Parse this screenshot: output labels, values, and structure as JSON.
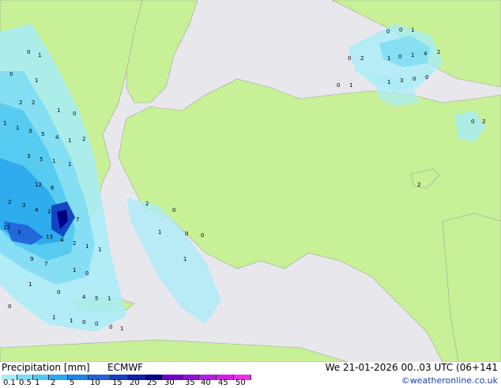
{
  "legend": {
    "title": "Precipitation [mm]",
    "model": "ECMWF",
    "valid_time": "We 21-01-2026 00..03 UTC (06+141",
    "credit": "©weatheronline.co.uk",
    "scale_labels": [
      "0.1",
      "0.5",
      "1",
      "2",
      "5",
      "10",
      "15",
      "20",
      "25",
      "30",
      "35",
      "40",
      "45",
      "50"
    ],
    "scale_colors": [
      "#a8ecf8",
      "#7cdcf4",
      "#50c8f0",
      "#2aa8ec",
      "#2080e8",
      "#2060d8",
      "#1840c0",
      "#1020a8",
      "#00008c",
      "#7000c8",
      "#9010d8",
      "#b020e0",
      "#d020e8",
      "#e830e8"
    ]
  },
  "colors": {
    "land": "#c8f096",
    "sea": "#e8e8ec",
    "coast": "#a0a0a0"
  },
  "map_labels": [
    "0",
    "0",
    "1",
    "0",
    "2",
    "1",
    "0",
    "1",
    "4",
    "2",
    "0",
    "1",
    "1",
    "3",
    "0",
    "0",
    "0",
    "1",
    "0",
    "1",
    "2",
    "2",
    "1",
    "0",
    "1",
    "1",
    "3",
    "5",
    "4",
    "1",
    "2",
    "12",
    "6",
    "3",
    "5",
    "1",
    "1",
    "2",
    "3",
    "4",
    "2",
    "17",
    "7",
    "12",
    "3",
    "13",
    "4",
    "2",
    "1",
    "1",
    "9",
    "7",
    "1",
    "0",
    "1",
    "0",
    "4",
    "5",
    "1",
    "0",
    "1",
    "1",
    "0",
    "0",
    "0",
    "1",
    "2",
    "0",
    "1",
    "0",
    "0",
    "1",
    "2",
    "0",
    "2"
  ]
}
